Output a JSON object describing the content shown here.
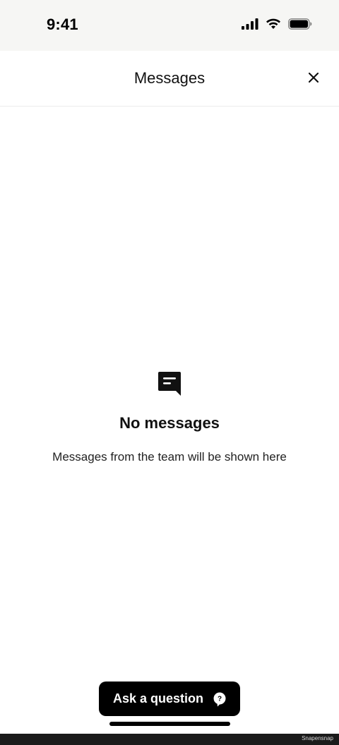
{
  "status_bar": {
    "time": "9:41",
    "icons": [
      "cellular-signal-icon",
      "wifi-icon",
      "battery-icon"
    ]
  },
  "header": {
    "title": "Messages",
    "close_icon": "close-icon"
  },
  "empty_state": {
    "icon": "chat-bubble-icon",
    "title": "No messages",
    "subtitle": "Messages from the team will be shown here"
  },
  "ask_button": {
    "label": "Ask a question",
    "icon": "question-bubble-icon"
  },
  "watermark": "Snapensnap",
  "colors": {
    "status_bar_bg": "#f6f6f4",
    "button_bg": "#000000",
    "text": "#111111",
    "divider": "#ececec"
  }
}
